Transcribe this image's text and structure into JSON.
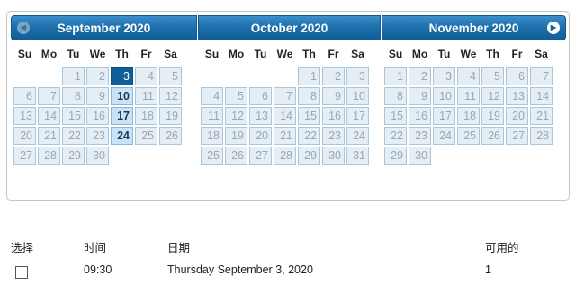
{
  "calendar": {
    "weekdays": [
      "Su",
      "Mo",
      "Tu",
      "We",
      "Th",
      "Fr",
      "Sa"
    ],
    "months": [
      {
        "title": "September 2020",
        "weeks": [
          [
            null,
            null,
            {
              "d": "1"
            },
            {
              "d": "2"
            },
            {
              "d": "3",
              "state": "selected"
            },
            {
              "d": "4"
            },
            {
              "d": "5"
            }
          ],
          [
            {
              "d": "6"
            },
            {
              "d": "7"
            },
            {
              "d": "8"
            },
            {
              "d": "9"
            },
            {
              "d": "10",
              "state": "available"
            },
            {
              "d": "11"
            },
            {
              "d": "12"
            }
          ],
          [
            {
              "d": "13"
            },
            {
              "d": "14"
            },
            {
              "d": "15"
            },
            {
              "d": "16"
            },
            {
              "d": "17",
              "state": "available"
            },
            {
              "d": "18"
            },
            {
              "d": "19"
            }
          ],
          [
            {
              "d": "20"
            },
            {
              "d": "21"
            },
            {
              "d": "22"
            },
            {
              "d": "23"
            },
            {
              "d": "24",
              "state": "available"
            },
            {
              "d": "25"
            },
            {
              "d": "26"
            }
          ],
          [
            {
              "d": "27"
            },
            {
              "d": "28"
            },
            {
              "d": "29"
            },
            {
              "d": "30"
            },
            null,
            null,
            null
          ]
        ]
      },
      {
        "title": "October 2020",
        "weeks": [
          [
            null,
            null,
            null,
            null,
            {
              "d": "1"
            },
            {
              "d": "2"
            },
            {
              "d": "3"
            }
          ],
          [
            {
              "d": "4"
            },
            {
              "d": "5"
            },
            {
              "d": "6"
            },
            {
              "d": "7"
            },
            {
              "d": "8"
            },
            {
              "d": "9"
            },
            {
              "d": "10"
            }
          ],
          [
            {
              "d": "11"
            },
            {
              "d": "12"
            },
            {
              "d": "13"
            },
            {
              "d": "14"
            },
            {
              "d": "15"
            },
            {
              "d": "16"
            },
            {
              "d": "17"
            }
          ],
          [
            {
              "d": "18"
            },
            {
              "d": "19"
            },
            {
              "d": "20"
            },
            {
              "d": "21"
            },
            {
              "d": "22"
            },
            {
              "d": "23"
            },
            {
              "d": "24"
            }
          ],
          [
            {
              "d": "25"
            },
            {
              "d": "26"
            },
            {
              "d": "27"
            },
            {
              "d": "28"
            },
            {
              "d": "29"
            },
            {
              "d": "30"
            },
            {
              "d": "31"
            }
          ]
        ]
      },
      {
        "title": "November 2020",
        "weeks": [
          [
            {
              "d": "1"
            },
            {
              "d": "2"
            },
            {
              "d": "3"
            },
            {
              "d": "4"
            },
            {
              "d": "5"
            },
            {
              "d": "6"
            },
            {
              "d": "7"
            }
          ],
          [
            {
              "d": "8"
            },
            {
              "d": "9"
            },
            {
              "d": "10"
            },
            {
              "d": "11"
            },
            {
              "d": "12"
            },
            {
              "d": "13"
            },
            {
              "d": "14"
            }
          ],
          [
            {
              "d": "15"
            },
            {
              "d": "16"
            },
            {
              "d": "17"
            },
            {
              "d": "18"
            },
            {
              "d": "19"
            },
            {
              "d": "20"
            },
            {
              "d": "21"
            }
          ],
          [
            {
              "d": "22"
            },
            {
              "d": "23"
            },
            {
              "d": "24"
            },
            {
              "d": "25"
            },
            {
              "d": "26"
            },
            {
              "d": "27"
            },
            {
              "d": "28"
            }
          ],
          [
            {
              "d": "29"
            },
            {
              "d": "30"
            },
            null,
            null,
            null,
            null,
            null
          ]
        ]
      }
    ],
    "prev_icon": "chevron-left-icon",
    "next_icon": "chevron-right-icon"
  },
  "slots": {
    "headers": {
      "select": "选择",
      "time": "时间",
      "date": "日期",
      "available": "可用的"
    },
    "rows": [
      {
        "time": "09:30",
        "date": "Thursday September 3, 2020",
        "available": "1",
        "checked": false
      }
    ]
  },
  "colors": {
    "header_blue": "#0f5e98",
    "selected": "#0f5e98",
    "available": "#c9e2f7"
  }
}
